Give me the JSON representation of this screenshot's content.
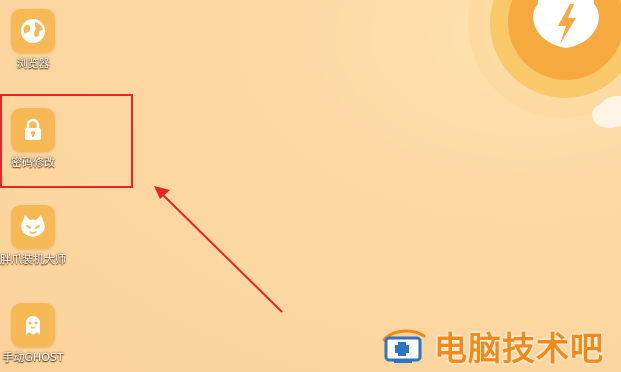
{
  "desktop": {
    "icons": [
      {
        "label": "浏览器",
        "icon": "globe-icon"
      },
      {
        "label": "密码修改",
        "icon": "lock-icon"
      },
      {
        "label": "胖爪装机大师",
        "icon": "cat-icon"
      },
      {
        "label": "手动GHOST",
        "icon": "ghost-icon"
      }
    ]
  },
  "annotation": {
    "highlight_target": "密码修改",
    "highlight_color": "#e32626"
  },
  "watermark": {
    "text": "电脑技术吧",
    "color": "#f28a1b"
  },
  "colors": {
    "background": "#fcd29c",
    "icon_tile": "#f7b955"
  }
}
